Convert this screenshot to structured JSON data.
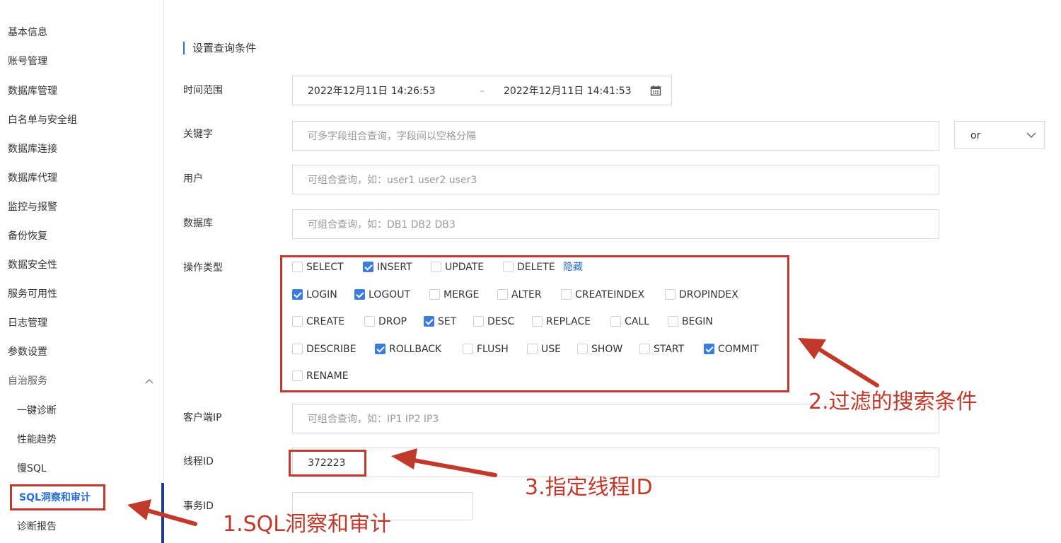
{
  "sidebar": {
    "items": [
      {
        "label": "基本信息"
      },
      {
        "label": "账号管理"
      },
      {
        "label": "数据库管理"
      },
      {
        "label": "白名单与安全组"
      },
      {
        "label": "数据库连接"
      },
      {
        "label": "数据库代理"
      },
      {
        "label": "监控与报警"
      },
      {
        "label": "备份恢复"
      },
      {
        "label": "数据安全性"
      },
      {
        "label": "服务可用性"
      },
      {
        "label": "日志管理"
      },
      {
        "label": "参数设置"
      }
    ],
    "group": {
      "label": "自治服务",
      "icon": "chevron-up-icon"
    },
    "sub_items": [
      {
        "label": "一键诊断"
      },
      {
        "label": "性能趋势"
      },
      {
        "label": "慢SQL"
      },
      {
        "label": "SQL洞察和审计",
        "active": true
      },
      {
        "label": "诊断报告"
      }
    ]
  },
  "section": {
    "title": "设置查询条件"
  },
  "form": {
    "time_range": {
      "label": "时间范围",
      "start": "2022年12月11日 14:26:53",
      "separator": "–",
      "end": "2022年12月11日 14:41:53",
      "icon": "calendar-icon"
    },
    "keyword": {
      "label": "关键字",
      "placeholder": "可多字段组合查询，字段间以空格分隔"
    },
    "logic": {
      "value": "or",
      "icon": "chevron-down-icon"
    },
    "user": {
      "label": "用户",
      "placeholder": "可组合查询，如：user1 user2 user3"
    },
    "database": {
      "label": "数据库",
      "placeholder": "可组合查询，如：DB1 DB2 DB3"
    },
    "op_type": {
      "label": "操作类型",
      "hide_link": "隐藏",
      "options": [
        {
          "label": "SELECT",
          "checked": false
        },
        {
          "label": "INSERT",
          "checked": true
        },
        {
          "label": "UPDATE",
          "checked": false
        },
        {
          "label": "DELETE",
          "checked": false
        },
        {
          "label": "LOGIN",
          "checked": true
        },
        {
          "label": "LOGOUT",
          "checked": true
        },
        {
          "label": "MERGE",
          "checked": false
        },
        {
          "label": "ALTER",
          "checked": false
        },
        {
          "label": "CREATEINDEX",
          "checked": false
        },
        {
          "label": "DROPINDEX",
          "checked": false
        },
        {
          "label": "CREATE",
          "checked": false
        },
        {
          "label": "DROP",
          "checked": false
        },
        {
          "label": "SET",
          "checked": true
        },
        {
          "label": "DESC",
          "checked": false
        },
        {
          "label": "REPLACE",
          "checked": false
        },
        {
          "label": "CALL",
          "checked": false
        },
        {
          "label": "BEGIN",
          "checked": false
        },
        {
          "label": "DESCRIBE",
          "checked": false
        },
        {
          "label": "ROLLBACK",
          "checked": true
        },
        {
          "label": "FLUSH",
          "checked": false
        },
        {
          "label": "USE",
          "checked": false
        },
        {
          "label": "SHOW",
          "checked": false
        },
        {
          "label": "START",
          "checked": false
        },
        {
          "label": "COMMIT",
          "checked": true
        },
        {
          "label": "RENAME",
          "checked": false
        }
      ]
    },
    "client_ip": {
      "label": "客户端IP",
      "placeholder": "可组合查询，如：IP1 IP2 IP3"
    },
    "thread_id": {
      "label": "线程ID",
      "value": "372223"
    },
    "txn_id": {
      "label": "事务ID",
      "value": ""
    }
  },
  "annotations": {
    "step1": "1.SQL洞察和审计",
    "step2": "2.过滤的搜索条件",
    "step3": "3.指定线程ID",
    "color": "#c0392b"
  },
  "colors": {
    "accent": "#2b6fd6",
    "checkbox_checked": "#3b7ddd",
    "annotation": "#c0392b"
  }
}
